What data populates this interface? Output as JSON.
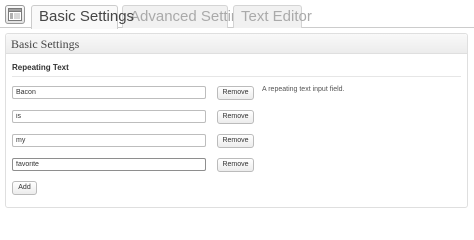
{
  "tabs": [
    {
      "label": "Basic Settings"
    },
    {
      "label": "Advanced Settings"
    },
    {
      "label": "Text Editor"
    }
  ],
  "panel": {
    "title": "Basic Settings",
    "section_title": "Repeating Text",
    "description": "A repeating text input field.",
    "fields": [
      {
        "value": "Bacon",
        "remove_label": "Remove"
      },
      {
        "value": "is",
        "remove_label": "Remove"
      },
      {
        "value": "my",
        "remove_label": "Remove"
      },
      {
        "value": "favorite",
        "remove_label": "Remove"
      }
    ],
    "add_label": "Add"
  }
}
